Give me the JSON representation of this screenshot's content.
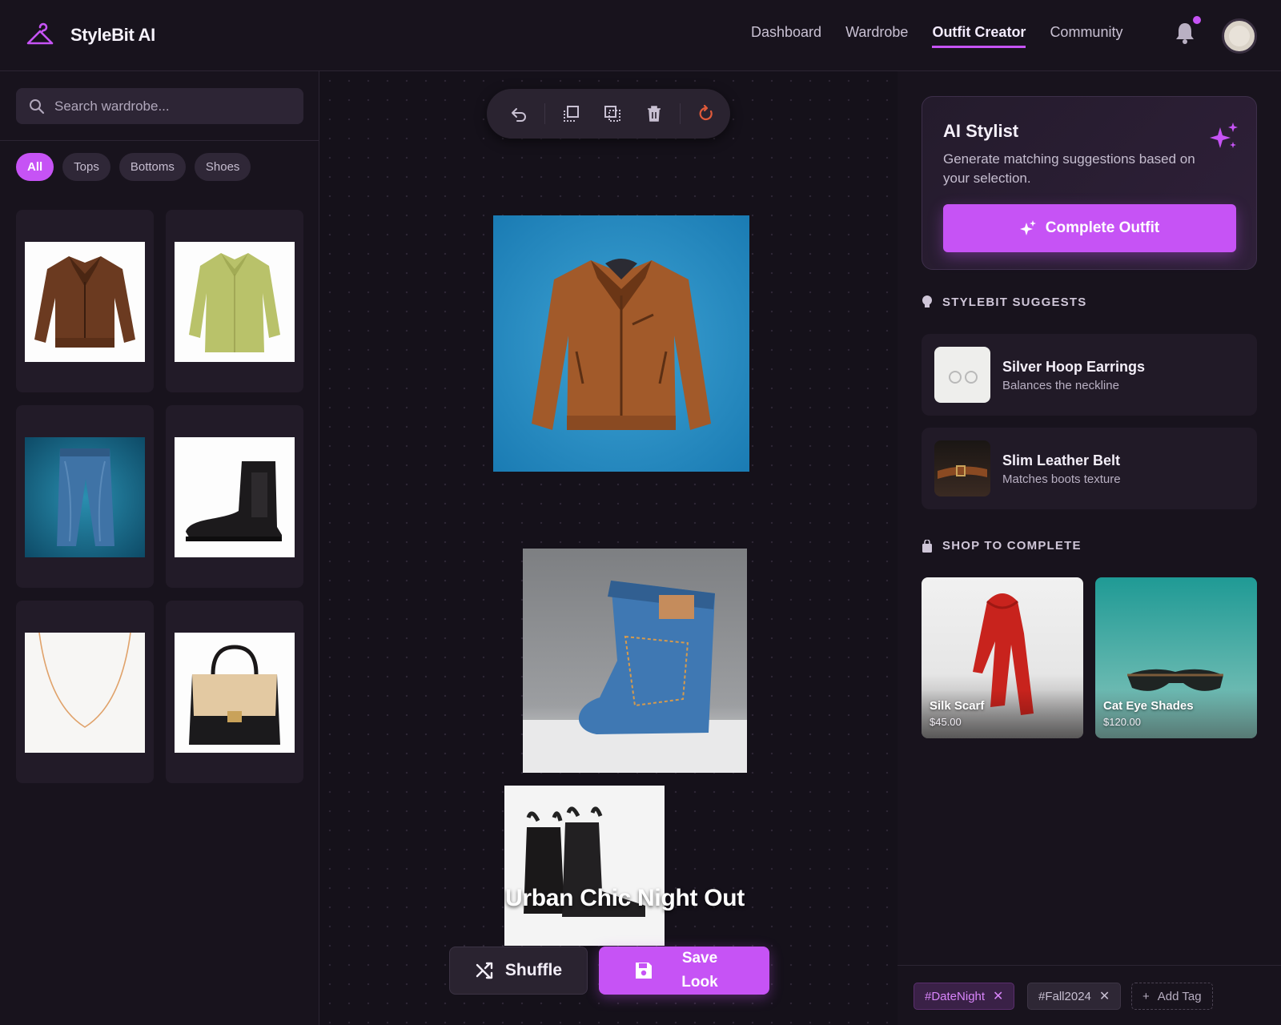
{
  "app": {
    "name": "StyleBit AI",
    "brand_color": "#c653f5"
  },
  "nav": {
    "items": [
      {
        "label": "Dashboard"
      },
      {
        "label": "Wardrobe"
      },
      {
        "label": "Outfit Creator",
        "active": true
      },
      {
        "label": "Community"
      }
    ],
    "notification_icon": "bell-icon",
    "has_unread": true
  },
  "sidebar": {
    "search_placeholder": "Search wardrobe...",
    "filters": [
      {
        "label": "All",
        "active": true
      },
      {
        "label": "Tops"
      },
      {
        "label": "Bottoms"
      },
      {
        "label": "Shoes"
      }
    ],
    "items": [
      {
        "kind": "leather jacket"
      },
      {
        "kind": "green blouse"
      },
      {
        "kind": "blue jeans"
      },
      {
        "kind": "chelsea boot"
      },
      {
        "kind": "gold necklace"
      },
      {
        "kind": "handbag"
      }
    ]
  },
  "canvas": {
    "toolbar": [
      "undo-icon",
      "bring-forward-icon",
      "select-area-icon",
      "delete-icon",
      "reset-icon"
    ],
    "outfit_title": "Urban Chic Night Out",
    "shuffle_label": "Shuffle",
    "save_label": "Save Look"
  },
  "ai_stylist": {
    "title": "AI Stylist",
    "description": "Generate matching suggestions based on your selection.",
    "button_label": "Complete Outfit"
  },
  "suggestions": {
    "heading": "STYLEBIT SUGGESTS",
    "items": [
      {
        "name": "Silver Hoop Earrings",
        "reason": "Balances the neckline"
      },
      {
        "name": "Slim Leather Belt",
        "reason": "Matches boots texture"
      }
    ]
  },
  "shop": {
    "heading": "SHOP TO COMPLETE",
    "items": [
      {
        "name": "Silk Scarf",
        "price": "$45.00"
      },
      {
        "name": "Cat Eye Shades",
        "price": "$120.00"
      }
    ]
  },
  "tags": {
    "items": [
      {
        "label": "#DateNight"
      },
      {
        "label": "#Fall2024"
      }
    ],
    "add_label": "Add Tag"
  }
}
